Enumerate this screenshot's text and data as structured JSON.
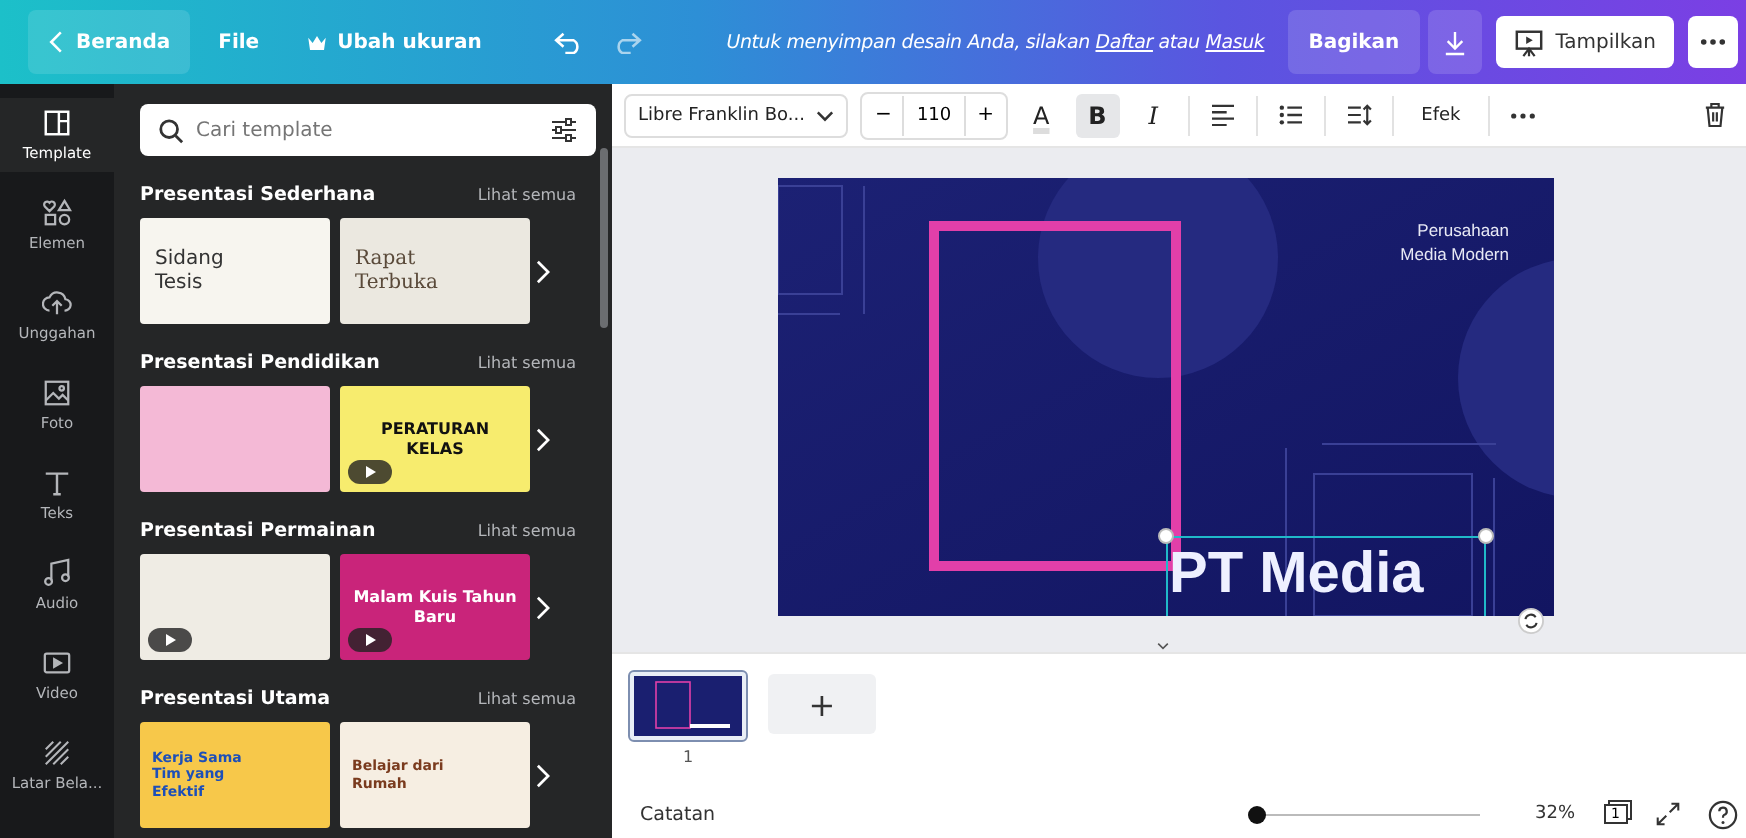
{
  "topbar": {
    "back": "Beranda",
    "file": "File",
    "resize": "Ubah ukuran",
    "notice_before": "Untuk menyimpan desain Anda, silakan",
    "signup": "Daftar",
    "notice_middle": "atau",
    "login": "Masuk",
    "share": "Bagikan",
    "present": "Tampilkan"
  },
  "toolbar": {
    "font": "Libre Franklin Bo...",
    "minus": "−",
    "size": "110",
    "plus": "+",
    "color_letter": "A",
    "bold": "B",
    "bold_on": true,
    "italic": "I",
    "effects": "Efek"
  },
  "rail": [
    {
      "label": "Template",
      "selected": true
    },
    {
      "label": "Elemen",
      "selected": false
    },
    {
      "label": "Unggahan",
      "selected": false
    },
    {
      "label": "Foto",
      "selected": false
    },
    {
      "label": "Teks",
      "selected": false
    },
    {
      "label": "Audio",
      "selected": false
    },
    {
      "label": "Video",
      "selected": false
    },
    {
      "label": "Latar Bela...",
      "selected": false
    }
  ],
  "panel": {
    "search": {
      "placeholder": "Cari template"
    },
    "sections": [
      {
        "title": "Presentasi Sederhana",
        "see_all": "Lihat semua",
        "templates": [
          {
            "title": "Sidang Tesis",
            "video": false
          },
          {
            "title": "Rapat Terbuka",
            "video": false
          }
        ]
      },
      {
        "title": "Presentasi Pendidikan",
        "see_all": "Lihat semua",
        "templates": [
          {
            "video": false
          },
          {
            "title": "PERATURAN KELAS",
            "video": true
          }
        ]
      },
      {
        "title": "Presentasi Permainan",
        "see_all": "Lihat semua",
        "templates": [
          {
            "video": true
          },
          {
            "title": "Malam Kuis Tahun Baru",
            "video": true
          }
        ]
      },
      {
        "title": "Presentasi Utama",
        "see_all": "Lihat semua",
        "templates": [
          {
            "title": "Kerja Sama Tim yang Efektif",
            "video": false
          },
          {
            "title": "Belajar dari Rumah",
            "video": false
          }
        ]
      }
    ]
  },
  "slide": {
    "tagline": [
      "Perusahaan",
      "Media Modern"
    ],
    "title": "PT Media",
    "title_selected": true
  },
  "pages": [
    {
      "number": "1",
      "selected": true
    }
  ],
  "add_page": "+",
  "footer": {
    "notes": "Catatan",
    "zoom": {
      "level": 0.0
    },
    "zoom_reading": "32%",
    "page_count": "1"
  }
}
